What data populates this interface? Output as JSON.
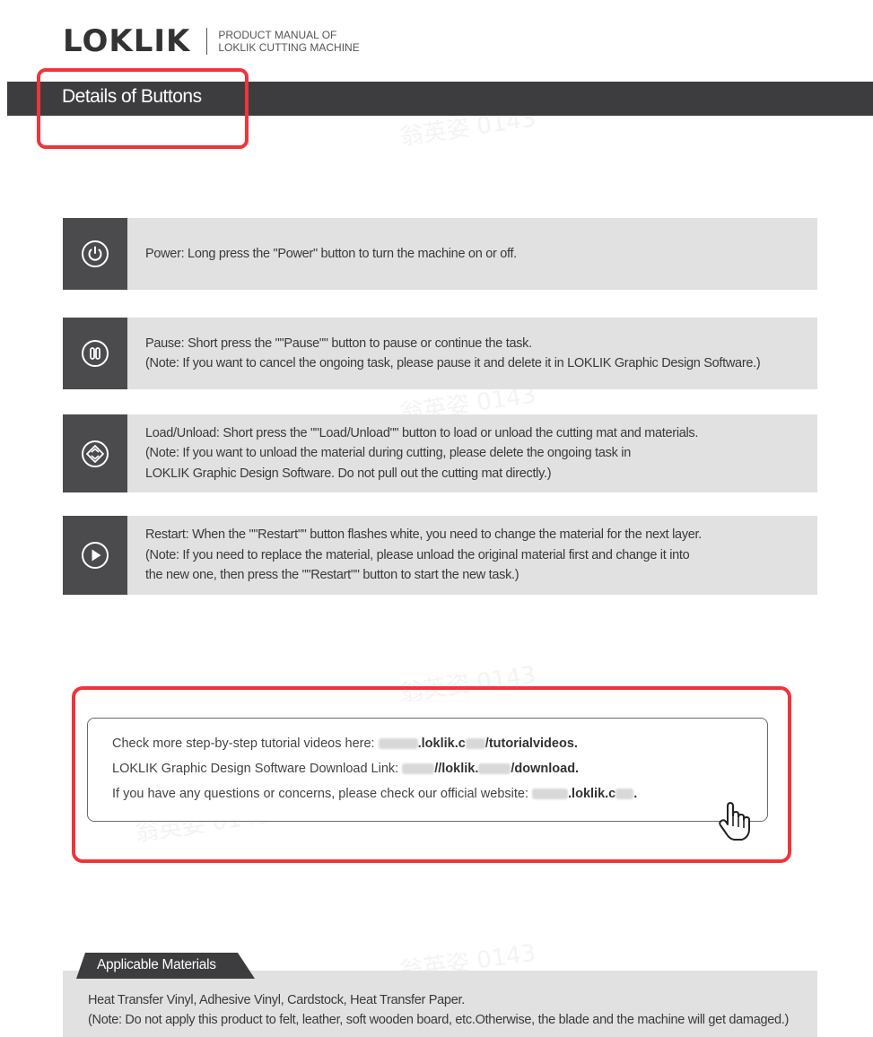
{
  "header": {
    "logo": "LOKLIK",
    "subtitle_line1": "PRODUCT MANUAL OF",
    "subtitle_line2": "LOKLIK CUTTING MACHINE"
  },
  "section_title": "Details of Buttons",
  "buttons": [
    {
      "icon": "power-icon",
      "lines": [
        "Power: Long press the \"Power\" button to turn the machine on or off."
      ]
    },
    {
      "icon": "pause-icon",
      "lines": [
        "Pause: Short press the \"\"Pause\"\" button to pause or continue the task.",
        "(Note: If you want to cancel the ongoing task, please pause it and delete it in LOKLIK Graphic Design Software.)"
      ]
    },
    {
      "icon": "load-unload-icon",
      "lines": [
        "Load/Unload: Short press the \"\"Load/Unload\"\" button to load or unload the cutting mat and materials.",
        "(Note: If you want to unload the material during cutting, please delete the ongoing task in",
        "LOKLIK Graphic Design Software. Do not pull out the cutting mat directly.)"
      ]
    },
    {
      "icon": "restart-icon",
      "lines": [
        "Restart: When the \"\"Restart\"\" button flashes white, you need to change the material for the next layer.",
        "(Note: If you need to replace the material, please unload the original material first and change it into",
        "the new one, then press the \"\"Restart\"\" button to start the new task.)"
      ]
    }
  ],
  "links": {
    "tutorial_label": "Check more step-by-step tutorial videos here:",
    "tutorial_url_part1": ".loklik.c",
    "tutorial_url_part2": "/tutorialvideos.",
    "download_label": "LOKLIK Graphic Design Software Download Link:",
    "download_url_part1": "//loklik.",
    "download_url_part2": "/download.",
    "website_label": "If you have any questions or concerns, please check our official website:",
    "website_url": ".loklik.c",
    "website_url_end": "."
  },
  "materials": {
    "tab_label": "Applicable Materials",
    "line1": "Heat Transfer Vinyl, Adhesive Vinyl, Cardstock, Heat Transfer Paper.",
    "line2": "(Note: Do not apply this product to felt, leather, soft wooden board, etc.Otherwise, the blade and the machine will get damaged.)"
  },
  "watermark": "翁英姿 0143",
  "colors": {
    "title_bar": "#3d3d3f",
    "icon_box": "#4b4b4d",
    "row_bg": "#e1e1e1",
    "highlight": "#f0343b"
  }
}
